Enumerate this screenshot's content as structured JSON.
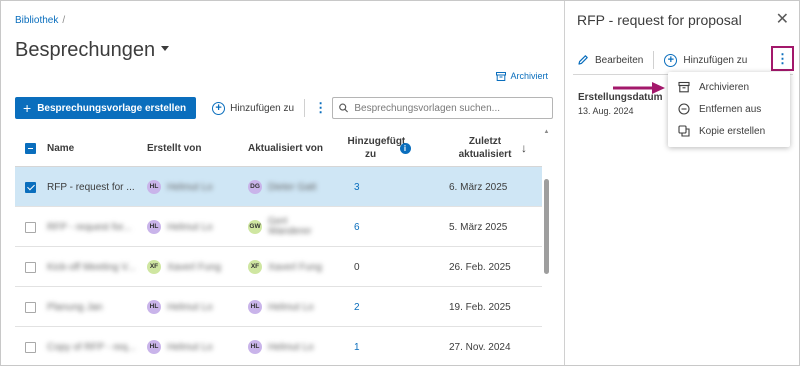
{
  "breadcrumb": {
    "root": "Bibliothek",
    "separator": "/"
  },
  "page": {
    "title": "Besprechungen"
  },
  "archive_link": {
    "label": "Archiviert"
  },
  "toolbar": {
    "create_label": "Besprechungsvorlage erstellen",
    "add_label": "Hinzufügen zu",
    "search_placeholder": "Besprechungsvorlagen suchen..."
  },
  "table": {
    "headers": {
      "name": "Name",
      "created_by": "Erstellt von",
      "updated_by": "Aktualisiert von",
      "added_to": "Hinzugefügt zu",
      "last_updated": "Zuletzt aktualisiert"
    },
    "rows": [
      {
        "name": "RFP - request for ...",
        "creator_initials": "HL",
        "creator_color": "#c9b4ea",
        "creator_name": "Helmut Lo",
        "updater_initials": "DG",
        "updater_color": "#c9b4ea",
        "updater_name": "Dieter Gatt",
        "added": "3",
        "date": "6. März 2025",
        "selected": true
      },
      {
        "name": "RFP - request for...",
        "creator_initials": "HL",
        "creator_color": "#c9b4ea",
        "creator_name": "Helmut Lo",
        "updater_initials": "GW",
        "updater_color": "#cfe6a1",
        "updater_name": "Gert Wanderer",
        "added": "6",
        "date": "5. März 2025",
        "selected": false
      },
      {
        "name": "Kick-off Meeting V...",
        "creator_initials": "XF",
        "creator_color": "#cfe6a1",
        "creator_name": "Xaverl Fung",
        "updater_initials": "XF",
        "updater_color": "#cfe6a1",
        "updater_name": "Xaverl Fung",
        "added": "0",
        "date": "26. Feb. 2025",
        "selected": false
      },
      {
        "name": "Planung Jan",
        "creator_initials": "HL",
        "creator_color": "#c9b4ea",
        "creator_name": "Helmut Lo",
        "updater_initials": "HL",
        "updater_color": "#c9b4ea",
        "updater_name": "Helmut Lo",
        "added": "2",
        "date": "19. Feb. 2025",
        "selected": false
      },
      {
        "name": "Copy of RFP - req...",
        "creator_initials": "HL",
        "creator_color": "#c9b4ea",
        "creator_name": "Helmut Lo",
        "updater_initials": "HL",
        "updater_color": "#c9b4ea",
        "updater_name": "Helmut Lo",
        "added": "1",
        "date": "27. Nov. 2024",
        "selected": false
      }
    ]
  },
  "panel": {
    "title": "RFP - request for proposal",
    "edit_label": "Bearbeiten",
    "add_label": "Hinzufügen zu",
    "field_label": "Erstellungsdatum",
    "field_value": "13. Aug. 2024"
  },
  "menu": {
    "items": [
      {
        "label": "Archivieren",
        "icon": "archive-icon"
      },
      {
        "label": "Entfernen aus",
        "icon": "remove-circle-icon"
      },
      {
        "label": "Kopie erstellen",
        "icon": "copy-icon"
      }
    ]
  },
  "colors": {
    "accent": "#0a6ebd",
    "highlight": "#a3186b",
    "selected_row": "#cfe6f5"
  }
}
